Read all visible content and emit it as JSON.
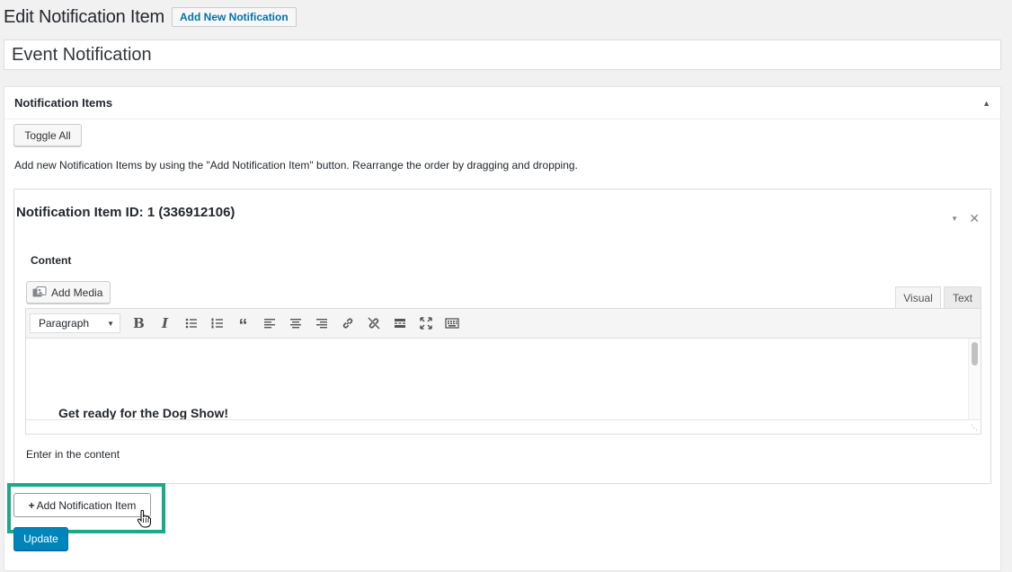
{
  "header": {
    "title": "Edit Notification Item",
    "add_new_label": "Add New Notification"
  },
  "post_title": {
    "value": "Event Notification"
  },
  "metabox": {
    "title": "Notification Items",
    "toggle_all_label": "Toggle All",
    "help_text": "Add new Notification Items by using the \"Add Notification Item\" button. Rearrange the order by dragging and dropping."
  },
  "item": {
    "title": "Notification Item ID: 1 (336912106)",
    "content_label": "Content",
    "add_media_label": "Add Media",
    "tabs": {
      "visual": "Visual",
      "text": "Text"
    },
    "format_select": "Paragraph",
    "toolbar_icons": [
      "bold-icon",
      "italic-icon",
      "bullet-list-icon",
      "numbered-list-icon",
      "blockquote-icon",
      "align-left-icon",
      "align-center-icon",
      "align-right-icon",
      "link-icon",
      "unlink-icon",
      "read-more-icon",
      "fullscreen-icon",
      "toolbar-toggle-icon"
    ],
    "editor_content": "Get ready for the Dog Show!",
    "field_description": "Enter in the content"
  },
  "actions": {
    "add_item_label": "Add Notification Item",
    "update_label": "Update"
  },
  "colors": {
    "link_blue": "#0073aa",
    "primary_button": "#0085ba",
    "highlight": "#1aaa88"
  }
}
